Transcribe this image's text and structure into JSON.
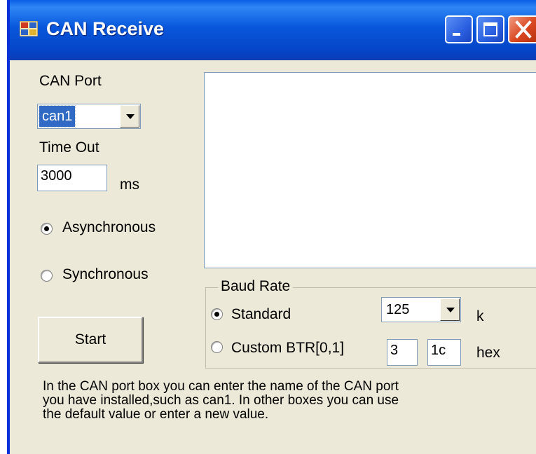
{
  "window": {
    "title": "CAN Receive"
  },
  "can_port": {
    "label": "CAN Port",
    "value": "can1"
  },
  "time_out": {
    "label": "Time Out",
    "value": "3000",
    "unit": "ms"
  },
  "mode": {
    "asynchronous_label": "Asynchronous",
    "synchronous_label": "Synchronous",
    "selected": "Asynchronous"
  },
  "start_label": "Start",
  "baud_rate": {
    "legend": "Baud Rate",
    "standard_label": "Standard",
    "standard_value": "125",
    "standard_unit": "k",
    "custom_label": "Custom BTR[0,1]",
    "btr0": "3",
    "btr1": "1c",
    "custom_unit": "hex",
    "selected": "Standard"
  },
  "help": {
    "line1": "In the CAN port box you can enter the name of the CAN port",
    "line2": "you have installed,such as can1. In other boxes you can use",
    "line3": "the default value or enter a new value."
  }
}
